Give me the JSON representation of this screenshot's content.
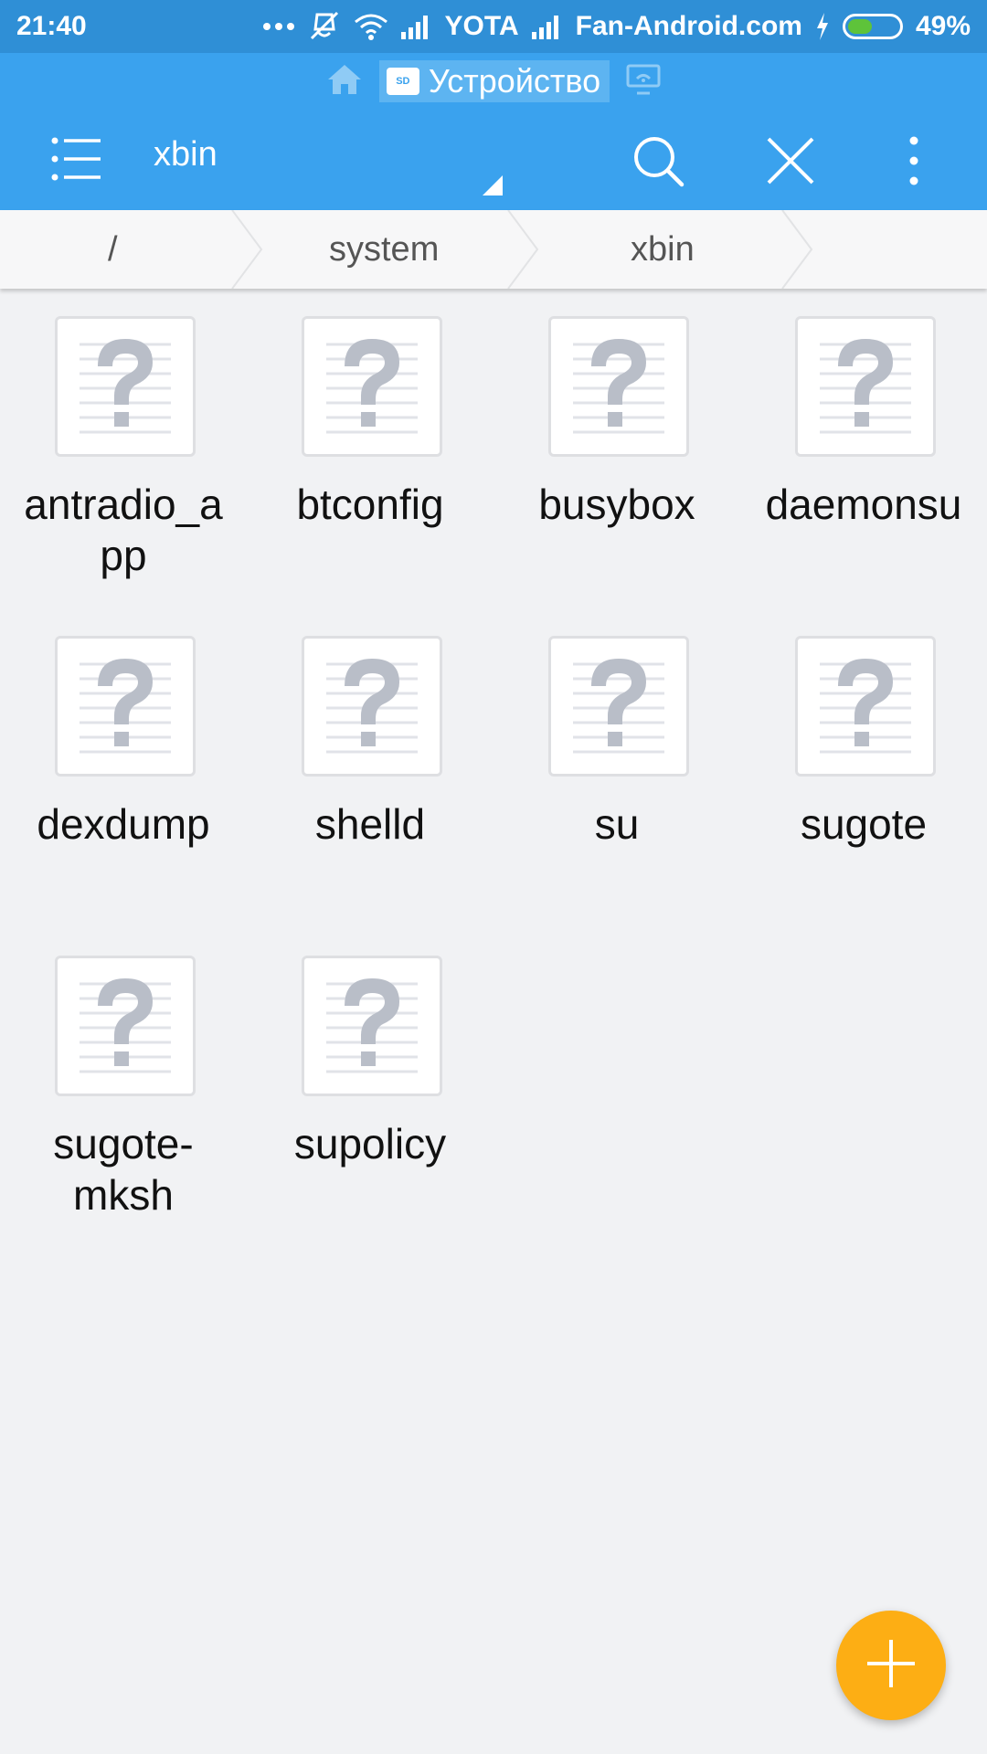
{
  "status_bar": {
    "time": "21:40",
    "carrier": "YOTA",
    "site": "Fan-Android.com",
    "battery_text": "49%",
    "battery_level": 0.49,
    "icons": [
      "more-dots-icon",
      "vibrate-off-icon",
      "wifi-icon",
      "signal-icon",
      "signal-icon",
      "charging-icon",
      "battery-icon"
    ]
  },
  "location": {
    "home_icon": "home-icon",
    "device_label": "Устройство",
    "sd_badge": "SD",
    "remote_icon": "remote-screen-icon"
  },
  "toolbar": {
    "title": "xbin",
    "icons": [
      "menu-icon",
      "search-icon",
      "close-icon",
      "more-vert-icon"
    ]
  },
  "breadcrumb": [
    "/",
    "system",
    "xbin"
  ],
  "files": [
    {
      "name": "antradio_a\npp"
    },
    {
      "name": "btconfig"
    },
    {
      "name": "busybox"
    },
    {
      "name": "daemonsu"
    },
    {
      "name": "dexdump"
    },
    {
      "name": "shelld"
    },
    {
      "name": "su"
    },
    {
      "name": "sugote"
    },
    {
      "name": "sugote-\nmksh"
    },
    {
      "name": "supolicy"
    }
  ],
  "fab": {
    "icon": "add-icon"
  },
  "colors": {
    "status_bar": "#2f8fd6",
    "app_bar": "#3aa2ee",
    "fab": "#fdae14",
    "background": "#f1f2f4"
  }
}
